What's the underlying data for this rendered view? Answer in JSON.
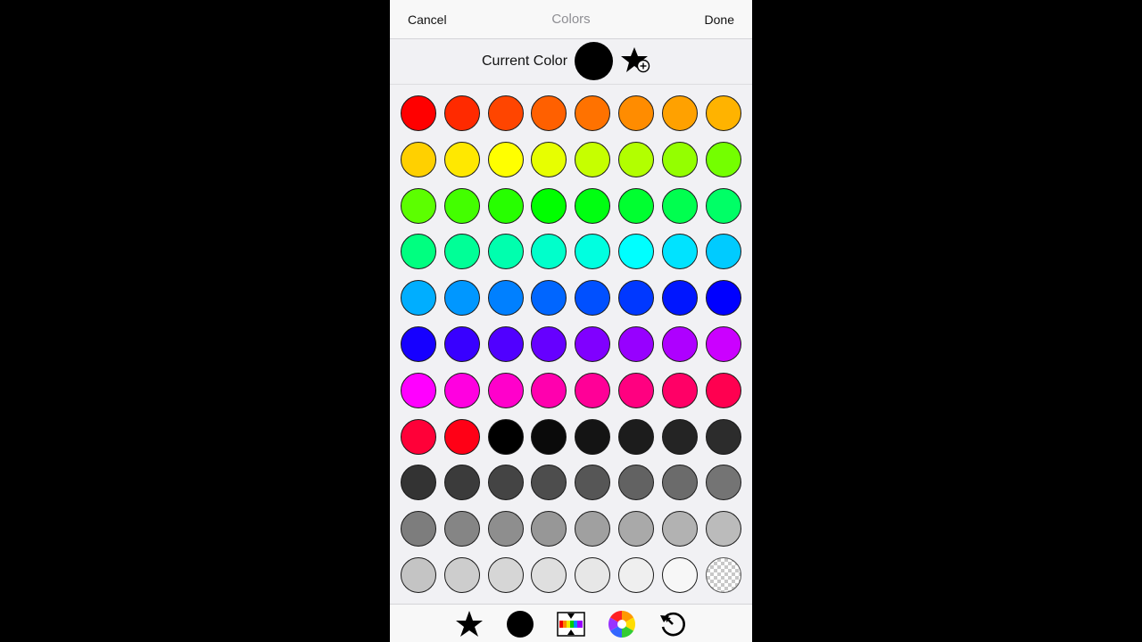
{
  "navbar": {
    "cancel_label": "Cancel",
    "title": "Colors",
    "done_label": "Done"
  },
  "current_color": {
    "label": "Current Color",
    "value": "#000000"
  },
  "palette": [
    [
      "#ff0000",
      "#ff2a00",
      "#ff4500",
      "#ff6000",
      "#ff7200",
      "#ff8c00",
      "#ffa100",
      "#ffb300"
    ],
    [
      "#ffd000",
      "#ffe800",
      "#ffff00",
      "#e7ff00",
      "#c6ff00",
      "#b2ff00",
      "#94ff00",
      "#74ff00"
    ],
    [
      "#5cff00",
      "#43ff00",
      "#27ff00",
      "#00ff00",
      "#00ff11",
      "#00ff30",
      "#00ff4f",
      "#00ff66"
    ],
    [
      "#00ff80",
      "#00ff97",
      "#00ffae",
      "#00ffcb",
      "#00ffe0",
      "#00ffff",
      "#00e3ff",
      "#00cbff"
    ],
    [
      "#00aeff",
      "#0097ff",
      "#0080ff",
      "#0066ff",
      "#0050ff",
      "#0038ff",
      "#0016ff",
      "#0000ff"
    ],
    [
      "#1600ff",
      "#3800ff",
      "#5000ff",
      "#6600ff",
      "#8000ff",
      "#9700ff",
      "#ae00ff",
      "#cb00ff"
    ],
    [
      "#ff00ff",
      "#ff00e0",
      "#ff00cb",
      "#ff00ae",
      "#ff0097",
      "#ff0080",
      "#ff0066",
      "#ff0050"
    ],
    [
      "#ff0038",
      "#ff0016",
      "#000000",
      "#0a0a0a",
      "#141414",
      "#1c1c1c",
      "#242424",
      "#2c2c2c"
    ],
    [
      "#333333",
      "#3b3b3b",
      "#444444",
      "#4d4d4d",
      "#565656",
      "#626262",
      "#6b6b6b",
      "#747474"
    ],
    [
      "#7d7d7d",
      "#858585",
      "#8e8e8e",
      "#979797",
      "#a0a0a0",
      "#a9a9a9",
      "#b2b2b2",
      "#bbbbbb"
    ],
    [
      "#c4c4c4",
      "#cdcdcd",
      "#d6d6d6",
      "#dfdfdf",
      "#e7e7e7",
      "#efefef",
      "#f7f7f7",
      "transparent"
    ]
  ],
  "toolbar": {
    "items": [
      {
        "name": "favorites",
        "icon": "star-icon"
      },
      {
        "name": "current-color",
        "icon": "filled-circle-icon"
      },
      {
        "name": "palette",
        "icon": "palette-slider-icon"
      },
      {
        "name": "color-wheel",
        "icon": "color-wheel-icon"
      },
      {
        "name": "history",
        "icon": "history-arrow-icon"
      }
    ]
  }
}
